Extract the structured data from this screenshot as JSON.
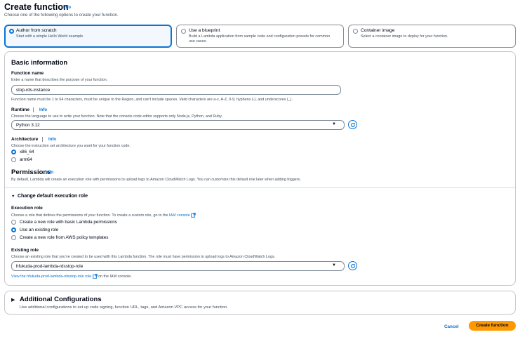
{
  "header": {
    "title": "Create function",
    "info": "Info",
    "subtitle": "Choose one of the following options to create your function."
  },
  "options": [
    {
      "title": "Author from scratch",
      "desc": "Start with a simple Hello World example.",
      "selected": true
    },
    {
      "title": "Use a blueprint",
      "desc": "Build a Lambda application from sample code and configuration presets for common use cases.",
      "selected": false
    },
    {
      "title": "Container image",
      "desc": "Select a container image to deploy for your function.",
      "selected": false
    }
  ],
  "basic": {
    "title": "Basic information",
    "function_name": {
      "label": "Function name",
      "desc": "Enter a name that describes the purpose of your function.",
      "value": "stop-rds-instance",
      "hint": "Function name must be 1 to 64 characters, must be unique to the Region, and can't include spaces. Valid characters are a-z, A-Z, 0-9, hyphens (-), and underscores (_)."
    },
    "runtime": {
      "label": "Runtime",
      "info": "Info",
      "desc": "Choose the language to use to write your function. Note that the console code editor supports only Node.js, Python, and Ruby.",
      "value": "Python 3.12"
    },
    "architecture": {
      "label": "Architecture",
      "info": "Info",
      "desc": "Choose the instruction set architecture you want for your function code.",
      "options": [
        {
          "label": "x86_64",
          "selected": true
        },
        {
          "label": "arm64",
          "selected": false
        }
      ]
    },
    "permissions": {
      "title": "Permissions",
      "info": "Info",
      "desc": "By default, Lambda will create an execution role with permissions to upload logs to Amazon CloudWatch Logs. You can customize this default role later when adding triggers."
    }
  },
  "execution": {
    "toggle_label": "Change default execution role",
    "role_label": "Execution role",
    "role_desc": "Choose a role that defines the permissions of your function. To create a custom role, go to the",
    "iam_link": "IAM console",
    "role_options": [
      {
        "label": "Create a new role with basic Lambda permissions",
        "selected": false
      },
      {
        "label": "Use an existing role",
        "selected": true
      },
      {
        "label": "Create a new role from AWS policy templates",
        "selected": false
      }
    ],
    "existing_label": "Existing role",
    "existing_desc": "Choose an existing role that you've created to be used with this Lambda function. The role must have permission to upload logs to Amazon CloudWatch Logs.",
    "existing_value": "hfukuda-prod-lambda-rdsstop-role",
    "view_link": "View the hfukuda-prod-lambda-rdsstop-role role",
    "view_suffix": "on the IAM console."
  },
  "additional": {
    "title": "Additional Configurations",
    "desc": "Use additional configurations to set up code signing, function URL, tags, and Amazon VPC access for your function."
  },
  "footer": {
    "cancel": "Cancel",
    "create": "Create function"
  },
  "colors": {
    "accent": "#0972d3",
    "primary_button": "#ff9900"
  }
}
